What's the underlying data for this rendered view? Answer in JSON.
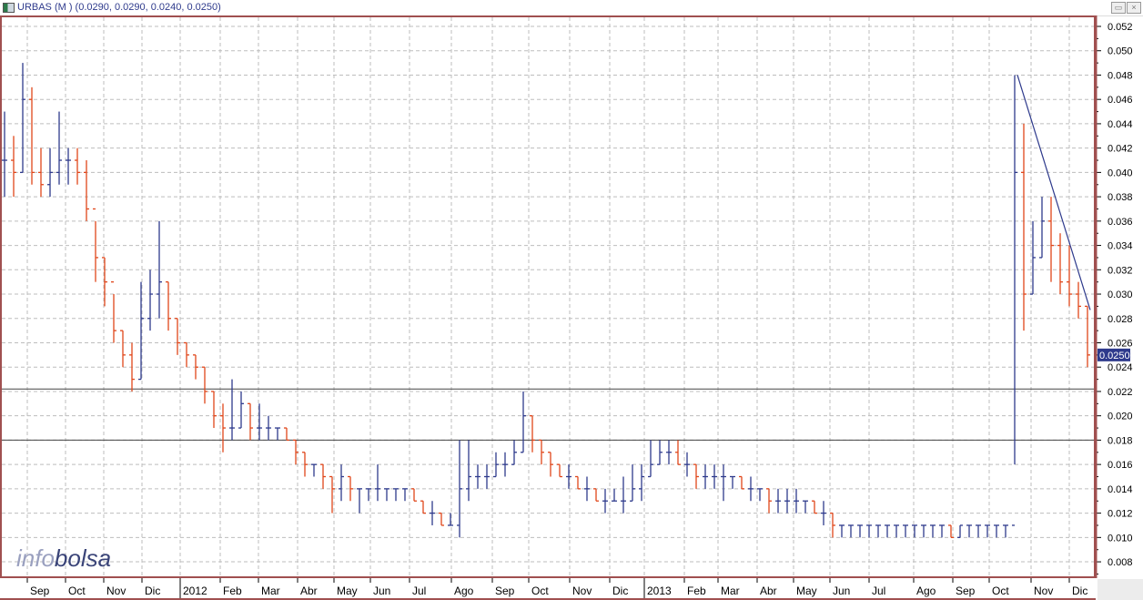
{
  "window": {
    "title": "URBAS (M ) (0.0290, 0.0290, 0.0240, 0.0250)",
    "restore_icon": "restore-icon",
    "close_icon": "close-icon"
  },
  "watermark": {
    "part1": "info",
    "part2": "bolsa"
  },
  "colors": {
    "up": "#2e3a8c",
    "down": "#e0461a",
    "frame": "#a05050",
    "grid": "#bdbdbd",
    "price_tag": "#2e3a8c"
  },
  "chart_data": {
    "type": "ohlc",
    "title": "URBAS (M )",
    "ylim": [
      0.007,
      0.053
    ],
    "y_ticks": [
      "0.052",
      "0.050",
      "0.048",
      "0.046",
      "0.044",
      "0.042",
      "0.040",
      "0.038",
      "0.036",
      "0.034",
      "0.032",
      "0.030",
      "0.028",
      "0.026",
      "0.024",
      "0.022",
      "0.020",
      "0.018",
      "0.016",
      "0.014",
      "0.012",
      "0.010",
      "0.008"
    ],
    "last_price_label": "0.0250",
    "last_price": 0.025,
    "x_unit": "week",
    "month_ticks": [
      {
        "label": "Sep",
        "week": 2.5
      },
      {
        "label": "Oct",
        "week": 6.7
      },
      {
        "label": "Nov",
        "week": 10.9
      },
      {
        "label": "Dic",
        "week": 15.1
      },
      {
        "label": "2012",
        "week": 19.3,
        "year": true
      },
      {
        "label": "Feb",
        "week": 23.7
      },
      {
        "label": "Mar",
        "week": 27.9
      },
      {
        "label": "Abr",
        "week": 32.2
      },
      {
        "label": "May",
        "week": 36.2
      },
      {
        "label": "Jun",
        "week": 40.2
      },
      {
        "label": "Jul",
        "week": 44.5
      },
      {
        "label": "Ago",
        "week": 49.1
      },
      {
        "label": "Sep",
        "week": 53.6
      },
      {
        "label": "Oct",
        "week": 57.6
      },
      {
        "label": "Nov",
        "week": 62.1
      },
      {
        "label": "Dic",
        "week": 66.5
      },
      {
        "label": "2013",
        "week": 70.3,
        "year": true
      },
      {
        "label": "Feb",
        "week": 74.7
      },
      {
        "label": "Mar",
        "week": 78.4
      },
      {
        "label": "Abr",
        "week": 82.7
      },
      {
        "label": "May",
        "week": 86.7
      },
      {
        "label": "Jun",
        "week": 90.7
      },
      {
        "label": "Jul",
        "week": 95.0
      },
      {
        "label": "Ago",
        "week": 99.9
      },
      {
        "label": "Sep",
        "week": 104.2
      },
      {
        "label": "Oct",
        "week": 108.2
      },
      {
        "label": "Nov",
        "week": 112.8
      },
      {
        "label": "Dic",
        "week": 117.0
      }
    ],
    "bars_low_high_close": [
      [
        0.038,
        0.045,
        0.041
      ],
      [
        0.038,
        0.043,
        0.04
      ],
      [
        0.04,
        0.049,
        0.046
      ],
      [
        0.039,
        0.047,
        0.04
      ],
      [
        0.038,
        0.042,
        0.039
      ],
      [
        0.038,
        0.042,
        0.04
      ],
      [
        0.039,
        0.045,
        0.041
      ],
      [
        0.039,
        0.042,
        0.041
      ],
      [
        0.039,
        0.042,
        0.04
      ],
      [
        0.036,
        0.041,
        0.037
      ],
      [
        0.031,
        0.036,
        0.033
      ],
      [
        0.029,
        0.033,
        0.031
      ],
      [
        0.026,
        0.03,
        0.027
      ],
      [
        0.024,
        0.027,
        0.025
      ],
      [
        0.022,
        0.026,
        0.023
      ],
      [
        0.023,
        0.031,
        0.028
      ],
      [
        0.027,
        0.032,
        0.03
      ],
      [
        0.028,
        0.036,
        0.031
      ],
      [
        0.027,
        0.031,
        0.028
      ],
      [
        0.025,
        0.028,
        0.026
      ],
      [
        0.024,
        0.026,
        0.025
      ],
      [
        0.023,
        0.025,
        0.024
      ],
      [
        0.021,
        0.024,
        0.022
      ],
      [
        0.019,
        0.022,
        0.02
      ],
      [
        0.017,
        0.021,
        0.019
      ],
      [
        0.018,
        0.023,
        0.019
      ],
      [
        0.019,
        0.022,
        0.021
      ],
      [
        0.018,
        0.021,
        0.019
      ],
      [
        0.018,
        0.021,
        0.019
      ],
      [
        0.018,
        0.02,
        0.019
      ],
      [
        0.018,
        0.019,
        0.019
      ],
      [
        0.018,
        0.019,
        0.018
      ],
      [
        0.016,
        0.018,
        0.017
      ],
      [
        0.015,
        0.017,
        0.016
      ],
      [
        0.015,
        0.016,
        0.016
      ],
      [
        0.014,
        0.016,
        0.015
      ],
      [
        0.012,
        0.015,
        0.014
      ],
      [
        0.013,
        0.016,
        0.015
      ],
      [
        0.013,
        0.015,
        0.014
      ],
      [
        0.012,
        0.014,
        0.014
      ],
      [
        0.013,
        0.014,
        0.014
      ],
      [
        0.013,
        0.016,
        0.014
      ],
      [
        0.013,
        0.014,
        0.014
      ],
      [
        0.013,
        0.014,
        0.014
      ],
      [
        0.013,
        0.014,
        0.014
      ],
      [
        0.013,
        0.014,
        0.013
      ],
      [
        0.012,
        0.013,
        0.012
      ],
      [
        0.011,
        0.013,
        0.012
      ],
      [
        0.011,
        0.012,
        0.011
      ],
      [
        0.011,
        0.012,
        0.011
      ],
      [
        0.01,
        0.018,
        0.014
      ],
      [
        0.013,
        0.018,
        0.015
      ],
      [
        0.014,
        0.016,
        0.015
      ],
      [
        0.014,
        0.016,
        0.015
      ],
      [
        0.015,
        0.017,
        0.016
      ],
      [
        0.015,
        0.017,
        0.016
      ],
      [
        0.016,
        0.018,
        0.017
      ],
      [
        0.017,
        0.022,
        0.02
      ],
      [
        0.017,
        0.02,
        0.018
      ],
      [
        0.016,
        0.018,
        0.017
      ],
      [
        0.015,
        0.017,
        0.016
      ],
      [
        0.015,
        0.016,
        0.015
      ],
      [
        0.014,
        0.016,
        0.015
      ],
      [
        0.014,
        0.015,
        0.014
      ],
      [
        0.013,
        0.015,
        0.014
      ],
      [
        0.013,
        0.014,
        0.013
      ],
      [
        0.012,
        0.014,
        0.013
      ],
      [
        0.013,
        0.014,
        0.013
      ],
      [
        0.012,
        0.015,
        0.013
      ],
      [
        0.013,
        0.016,
        0.014
      ],
      [
        0.013,
        0.016,
        0.015
      ],
      [
        0.015,
        0.018,
        0.016
      ],
      [
        0.016,
        0.018,
        0.017
      ],
      [
        0.016,
        0.018,
        0.017
      ],
      [
        0.016,
        0.018,
        0.016
      ],
      [
        0.015,
        0.017,
        0.016
      ],
      [
        0.014,
        0.016,
        0.015
      ],
      [
        0.014,
        0.016,
        0.015
      ],
      [
        0.014,
        0.016,
        0.015
      ],
      [
        0.013,
        0.016,
        0.015
      ],
      [
        0.014,
        0.015,
        0.015
      ],
      [
        0.014,
        0.015,
        0.014
      ],
      [
        0.013,
        0.015,
        0.014
      ],
      [
        0.013,
        0.014,
        0.014
      ],
      [
        0.012,
        0.014,
        0.013
      ],
      [
        0.012,
        0.014,
        0.013
      ],
      [
        0.012,
        0.014,
        0.013
      ],
      [
        0.012,
        0.014,
        0.013
      ],
      [
        0.012,
        0.013,
        0.013
      ],
      [
        0.012,
        0.013,
        0.012
      ],
      [
        0.011,
        0.013,
        0.012
      ],
      [
        0.01,
        0.012,
        0.011
      ],
      [
        0.01,
        0.011,
        0.011
      ],
      [
        0.01,
        0.011,
        0.011
      ],
      [
        0.01,
        0.011,
        0.011
      ],
      [
        0.01,
        0.011,
        0.011
      ],
      [
        0.01,
        0.011,
        0.011
      ],
      [
        0.01,
        0.011,
        0.011
      ],
      [
        0.01,
        0.011,
        0.011
      ],
      [
        0.01,
        0.011,
        0.011
      ],
      [
        0.01,
        0.011,
        0.011
      ],
      [
        0.01,
        0.011,
        0.011
      ],
      [
        0.01,
        0.011,
        0.011
      ],
      [
        0.01,
        0.011,
        0.011
      ],
      [
        0.01,
        0.011,
        0.01
      ],
      [
        0.01,
        0.011,
        0.011
      ],
      [
        0.01,
        0.011,
        0.011
      ],
      [
        0.01,
        0.011,
        0.011
      ],
      [
        0.01,
        0.011,
        0.011
      ],
      [
        0.01,
        0.011,
        0.011
      ],
      [
        0.01,
        0.011,
        0.011
      ],
      [
        0.016,
        0.048,
        0.04
      ],
      [
        0.027,
        0.044,
        0.03
      ],
      [
        0.03,
        0.036,
        0.033
      ],
      [
        0.033,
        0.038,
        0.036
      ],
      [
        0.031,
        0.038,
        0.034
      ],
      [
        0.03,
        0.035,
        0.031
      ],
      [
        0.029,
        0.034,
        0.03
      ],
      [
        0.028,
        0.031,
        0.029
      ],
      [
        0.024,
        0.029,
        0.025
      ]
    ],
    "horizontal_lines": [
      0.0222,
      0.018
    ],
    "trendline": {
      "from": {
        "week": 111.3,
        "value": 0.048
      },
      "to": {
        "week": 119.3,
        "value": 0.0287
      }
    }
  }
}
